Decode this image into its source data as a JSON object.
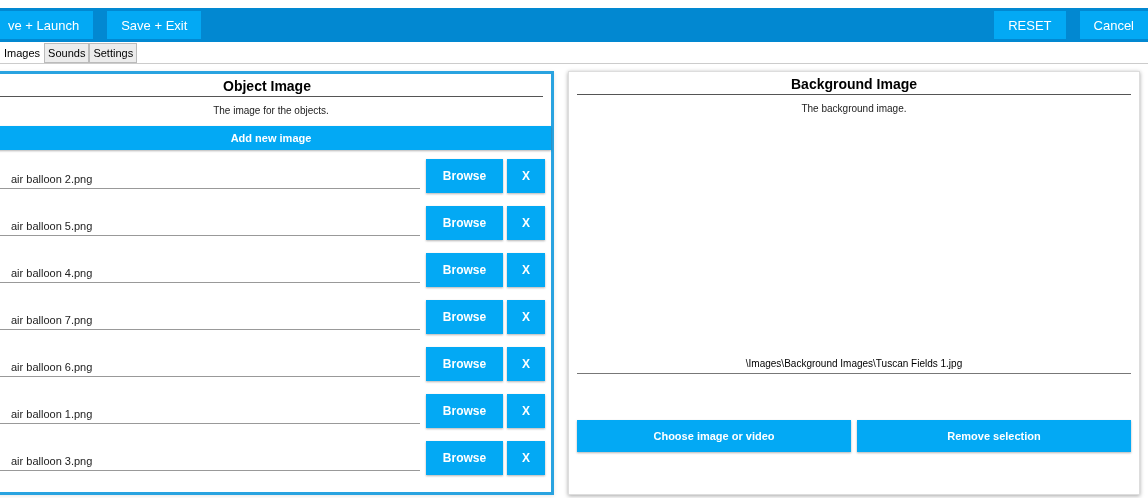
{
  "toolbar": {
    "left_buttons": [
      "ve + Launch",
      "Save + Exit"
    ],
    "right_buttons": [
      "RESET",
      "Cancel"
    ]
  },
  "tabs": [
    {
      "label": "Images",
      "selected": true
    },
    {
      "label": "Sounds",
      "selected": false
    },
    {
      "label": "Settings",
      "selected": false
    }
  ],
  "object_image": {
    "title": "Object Image",
    "description": "The image for the objects.",
    "add_button": "Add new image",
    "selected": true,
    "files": [
      {
        "value": "air balloon 2.png",
        "browse": "Browse",
        "remove": "X"
      },
      {
        "value": "air balloon 5.png",
        "browse": "Browse",
        "remove": "X"
      },
      {
        "value": "air balloon 4.png",
        "browse": "Browse",
        "remove": "X"
      },
      {
        "value": "air balloon 7.png",
        "browse": "Browse",
        "remove": "X"
      },
      {
        "value": "air balloon 6.png",
        "browse": "Browse",
        "remove": "X"
      },
      {
        "value": "air balloon 1.png",
        "browse": "Browse",
        "remove": "X"
      },
      {
        "value": "air balloon 3.png",
        "browse": "Browse",
        "remove": "X"
      }
    ]
  },
  "background_image": {
    "title": "Background Image",
    "description": "The background image.",
    "selected": false,
    "path": "\\Images\\Background Images\\Tuscan Fields 1.jpg",
    "buttons": [
      "Choose image or video",
      "Remove selection"
    ]
  }
}
